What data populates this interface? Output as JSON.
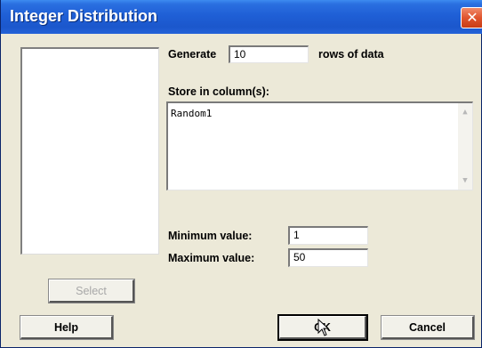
{
  "window": {
    "title": "Integer Distribution",
    "close_glyph": "✕"
  },
  "generate": {
    "label": "Generate",
    "value": "10",
    "suffix": "rows of data"
  },
  "store": {
    "label": "Store in column(s):",
    "value": "Random1"
  },
  "minimum": {
    "label": "Minimum value:",
    "value": "1"
  },
  "maximum": {
    "label": "Maximum value:",
    "value": "50"
  },
  "buttons": {
    "select": "Select",
    "help": "Help",
    "ok": "OK",
    "cancel": "Cancel"
  },
  "icons": {
    "close": "close-icon",
    "cursor": "mouse-pointer-icon",
    "scroll_up": "scroll-up-arrow-icon",
    "scroll_down": "scroll-down-arrow-icon"
  },
  "colors": {
    "title_bar": "#1f5fd6",
    "close_button": "#e0552e",
    "dialog_bg": "#ece9d8"
  }
}
